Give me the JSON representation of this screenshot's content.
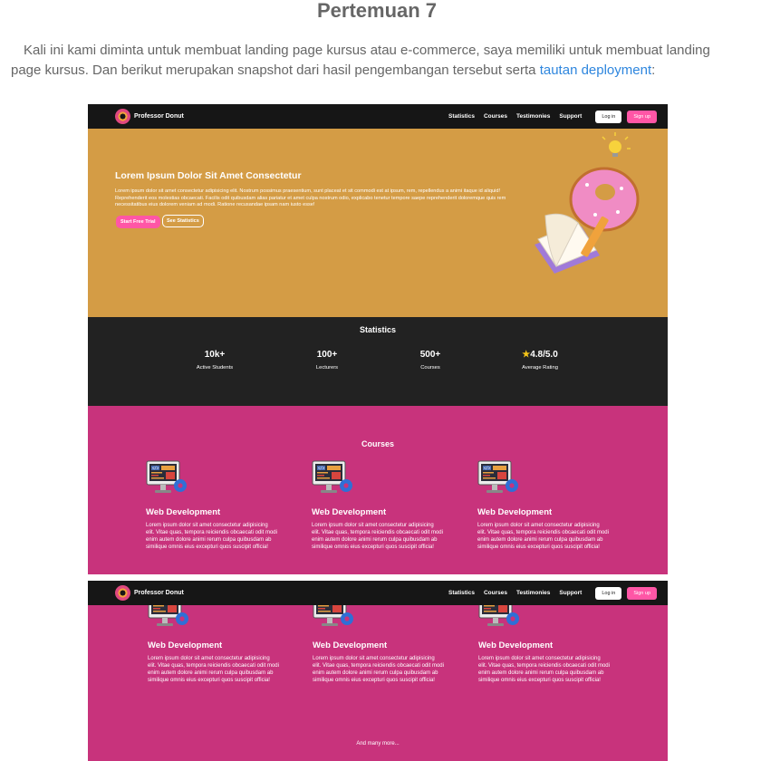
{
  "article": {
    "title": "Pertemuan 7",
    "intro_text": "Kali ini kami diminta untuk membuat landing page kursus atau e-commerce, saya memiliki untuk membuat landing page kursus. Dan berikut merupakan snapshot dari hasil pengembangan tersebut serta ",
    "link_text": "tautan deployment",
    "intro_end": ":"
  },
  "nav": {
    "brand": "Professor Donut",
    "links": [
      "Statistics",
      "Courses",
      "Testimonies",
      "Support"
    ],
    "login": "Log in",
    "signup": "Sign up"
  },
  "hero": {
    "title": "Lorem Ipsum Dolor Sit Amet Consectetur",
    "text": "Lorem ipsum dolor sit amet consectetur adipisicing elit. Nostrum possimus praesentium, sunt placeat et sit commodi est at ipsum, rem, repellendus a animi itaque id aliquid! Reprehenderit eos molestias obcaecati. Facilis odit quibusdam alias pariatur et amet culpa nostrum odio, explicabo tenetur tempore saepe reprehenderit doloremque quis rem necessitatibus eius dolorem veniam ad modi. Ratione recusandae ipsam nam iusto esse!",
    "btn_trial": "Start Free Trial",
    "btn_stats": "See Statistics"
  },
  "stats": {
    "heading": "Statistics",
    "items": [
      {
        "value": "10k+",
        "label": "Active Students"
      },
      {
        "value": "100+",
        "label": "Lecturers"
      },
      {
        "value": "500+",
        "label": "Courses"
      },
      {
        "value": "4.8/5.0",
        "label": "Average Rating",
        "star": "★"
      }
    ]
  },
  "courses": {
    "heading": "Courses",
    "items": [
      {
        "title": "Web Development",
        "desc": "Lorem ipsum dolor sit amet consectetur adipisicing elit. Vitae quas, tempora reiciendis obcaecati odit modi enim autem dolore animi rerum culpa quibusdam ab similique omnis eius excepturi quos suscipit officia!"
      },
      {
        "title": "Web Development",
        "desc": "Lorem ipsum dolor sit amet consectetur adipisicing elit. Vitae quas, tempora reiciendis obcaecati odit modi enim autem dolore animi rerum culpa quibusdam ab similique omnis eius excepturi quos suscipit officia!"
      },
      {
        "title": "Web Development",
        "desc": "Lorem ipsum dolor sit amet consectetur adipisicing elit. Vitae quas, tempora reiciendis obcaecati odit modi enim autem dolore animi rerum culpa quibusdam ab similique omnis eius excepturi quos suscipit officia!"
      }
    ],
    "more": "And many more..."
  },
  "colors": {
    "navbar": "#161616",
    "hero_bg": "#d49c45",
    "stats_bg": "#222222",
    "courses_bg": "#c8337c",
    "accent_pink": "#ff56a6",
    "link_blue": "#2e86de"
  }
}
